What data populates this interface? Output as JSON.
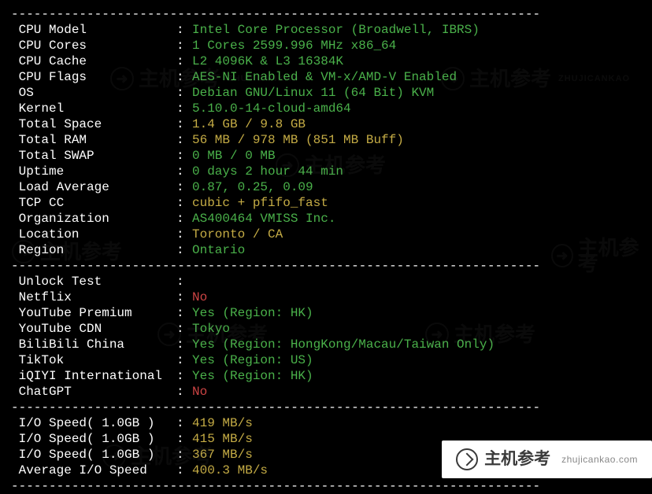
{
  "separator": "----------------------------------------------------------------------",
  "sysinfo": [
    {
      "label": " CPU Model",
      "value": "Intel Core Processor (Broadwell, IBRS)",
      "color": "green"
    },
    {
      "label": " CPU Cores",
      "value": "1 Cores 2599.996 MHz x86_64",
      "color": "green"
    },
    {
      "label": " CPU Cache",
      "value": "L2 4096K & L3 16384K",
      "color": "green"
    },
    {
      "label": " CPU Flags",
      "value": "AES-NI Enabled & VM-x/AMD-V Enabled",
      "color": "green"
    },
    {
      "label": " OS",
      "value": "Debian GNU/Linux 11 (64 Bit) KVM",
      "color": "green"
    },
    {
      "label": " Kernel",
      "value": "5.10.0-14-cloud-amd64",
      "color": "green"
    },
    {
      "label": " Total Space",
      "value": "1.4 GB / 9.8 GB",
      "color": "yellow"
    },
    {
      "label": " Total RAM",
      "value": "56 MB / 978 MB (851 MB Buff)",
      "color": "yellow"
    },
    {
      "label": " Total SWAP",
      "value": "0 MB / 0 MB",
      "color": "green"
    },
    {
      "label": " Uptime",
      "value": "0 days 2 hour 44 min",
      "color": "green"
    },
    {
      "label": " Load Average",
      "value": "0.87, 0.25, 0.09",
      "color": "green"
    },
    {
      "label": " TCP CC",
      "value": "cubic + pfifo_fast",
      "color": "yellow"
    },
    {
      "label": " Organization",
      "value": "AS400464 VMISS Inc.",
      "color": "green"
    },
    {
      "label": " Location",
      "value": "Toronto / CA",
      "color": "yellow"
    },
    {
      "label": " Region",
      "value": "Ontario",
      "color": "green"
    }
  ],
  "unlock_header": {
    "label": " Unlock Test",
    "value": ""
  },
  "unlock": [
    {
      "label": " Netflix",
      "value": "No",
      "color": "red"
    },
    {
      "label": " YouTube Premium",
      "value": "Yes (Region: HK)",
      "color": "green"
    },
    {
      "label": " YouTube CDN",
      "value": "Tokyo",
      "color": "green"
    },
    {
      "label": " BiliBili China",
      "value": "Yes (Region: HongKong/Macau/Taiwan Only)",
      "color": "green"
    },
    {
      "label": " TikTok",
      "value": "Yes (Region: US)",
      "color": "green"
    },
    {
      "label": " iQIYI International",
      "value": "Yes (Region: HK)",
      "color": "green"
    },
    {
      "label": " ChatGPT",
      "value": "No",
      "color": "red"
    }
  ],
  "io": [
    {
      "label": " I/O Speed( 1.0GB )",
      "value": "419 MB/s",
      "color": "yellow"
    },
    {
      "label": " I/O Speed( 1.0GB )",
      "value": "415 MB/s",
      "color": "yellow"
    },
    {
      "label": " I/O Speed( 1.0GB )",
      "value": "367 MB/s",
      "color": "yellow"
    },
    {
      "label": " Average I/O Speed",
      "value": "400.3 MB/s",
      "color": "yellow"
    }
  ],
  "watermark": {
    "text": "主机参考",
    "url": "zhujicankao.com",
    "short": "ZHUJICANKAO"
  }
}
